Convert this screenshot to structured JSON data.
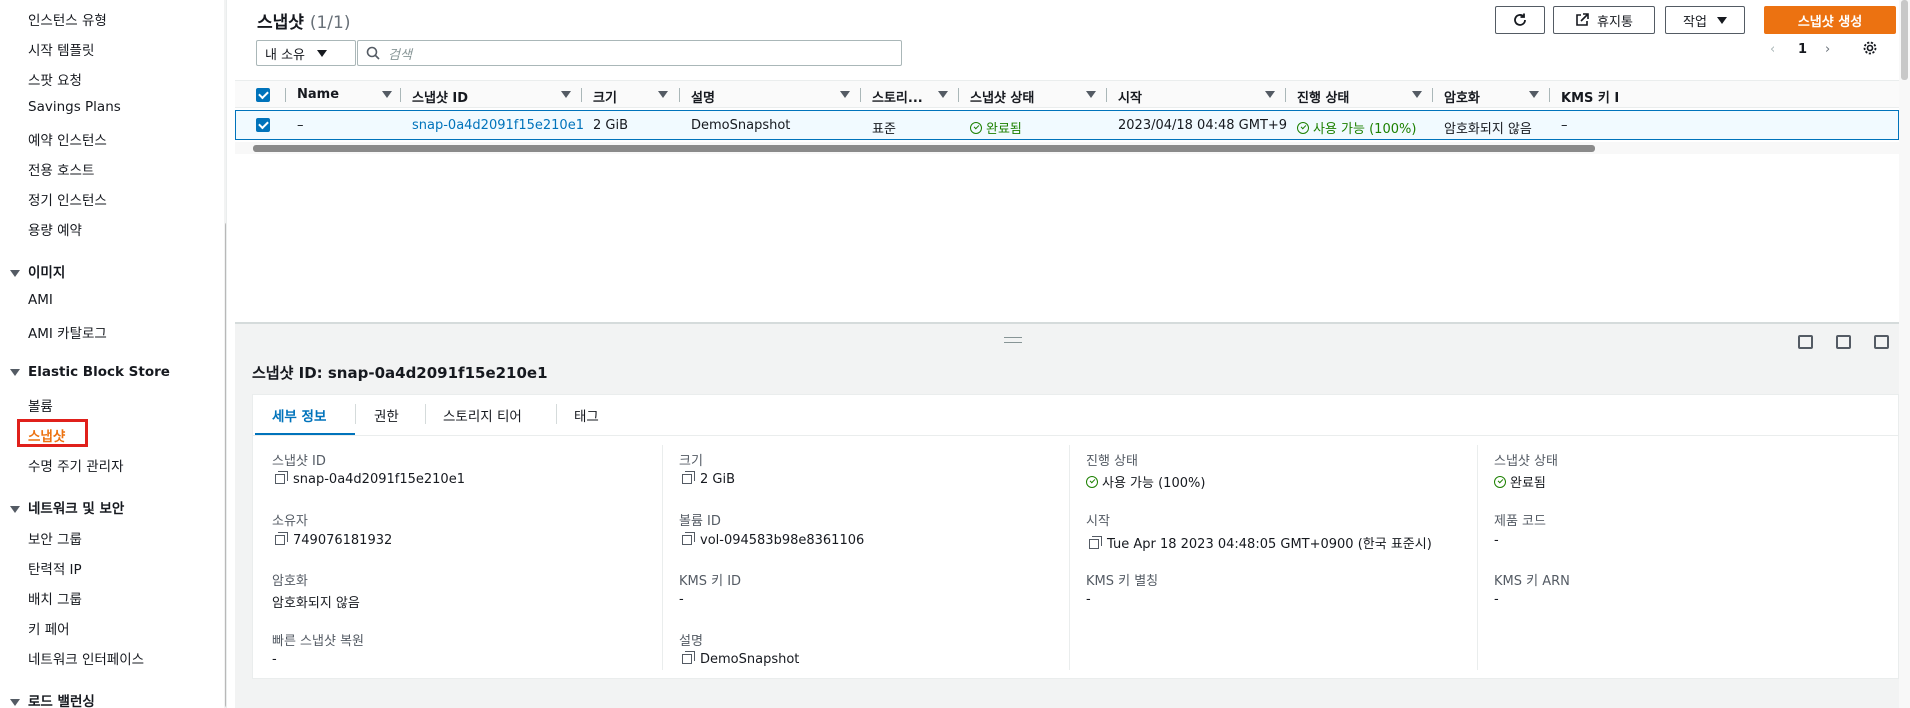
{
  "sidebar": {
    "items_top": [
      "인스턴스 유형",
      "시작 템플릿",
      "스팟 요청",
      "Savings Plans",
      "예약 인스턴스",
      "전용 호스트",
      "정기 인스턴스",
      "용량 예약"
    ],
    "images_section": "이미지",
    "images_items": [
      "AMI",
      "AMI 카탈로그"
    ],
    "ebs_section": "Elastic Block Store",
    "ebs_items": [
      "볼륨",
      "스냅샷",
      "수명 주기 관리자"
    ],
    "network_section": "네트워크 및 보안",
    "network_items": [
      "보안 그룹",
      "탄력적 IP",
      "배치 그룹",
      "키 페어",
      "네트워크 인터페이스"
    ],
    "lb_section": "로드 밸런싱"
  },
  "header": {
    "title": "스냅샷",
    "count": "(1/1)",
    "refresh_icon": "refresh-icon",
    "recycle_bin_label": "휴지통",
    "actions_label": "작업",
    "create_label": "스냅샷 생성",
    "owner_filter": "내 소유",
    "search_placeholder": "검색",
    "page_number": "1"
  },
  "table": {
    "columns": [
      "Name",
      "스냅샷 ID",
      "크기",
      "설명",
      "스토리...",
      "스냅샷 상태",
      "시작",
      "진행 상태",
      "암호화",
      "KMS 키 I"
    ],
    "row": {
      "name": "–",
      "snapshot_id": "snap-0a4d2091f15e210e1",
      "size": "2 GiB",
      "description": "DemoSnapshot",
      "storage": "표준",
      "state": "완료됨",
      "started": "2023/04/18 04:48 GMT+9",
      "progress": "사용 가능 (100%)",
      "encryption": "암호화되지 않음",
      "kms": "–"
    }
  },
  "detail": {
    "title": "스냅샷 ID: snap-0a4d2091f15e210e1",
    "tabs": [
      "세부 정보",
      "권한",
      "스토리지 티어",
      "태그"
    ],
    "fields": {
      "snapshot_id_label": "스냅샷 ID",
      "snapshot_id": "snap-0a4d2091f15e210e1",
      "owner_label": "소유자",
      "owner": "749076181932",
      "encryption_label": "암호화",
      "encryption": "암호화되지 않음",
      "fast_restore_label": "빠른 스냅샷 복원",
      "fast_restore": "-",
      "size_label": "크기",
      "size": "2 GiB",
      "volume_id_label": "볼륨 ID",
      "volume_id": "vol-094583b98e8361106",
      "kms_id_label": "KMS 키 ID",
      "kms_id": "-",
      "description_label": "설명",
      "description": "DemoSnapshot",
      "progress_label": "진행 상태",
      "progress": "사용 가능 (100%)",
      "started_label": "시작",
      "started": "Tue Apr 18 2023 04:48:05 GMT+0900 (한국 표준시)",
      "kms_alias_label": "KMS 키 별칭",
      "kms_alias": "-",
      "state_label": "스냅샷 상태",
      "state": "완료됨",
      "product_code_label": "제품 코드",
      "product_code": "-",
      "kms_arn_label": "KMS 키 ARN",
      "kms_arn": "-"
    }
  },
  "colors": {
    "accent": "#ec7211",
    "link": "#0073bb",
    "success": "#1d8102",
    "highlight": "#e0201b"
  }
}
